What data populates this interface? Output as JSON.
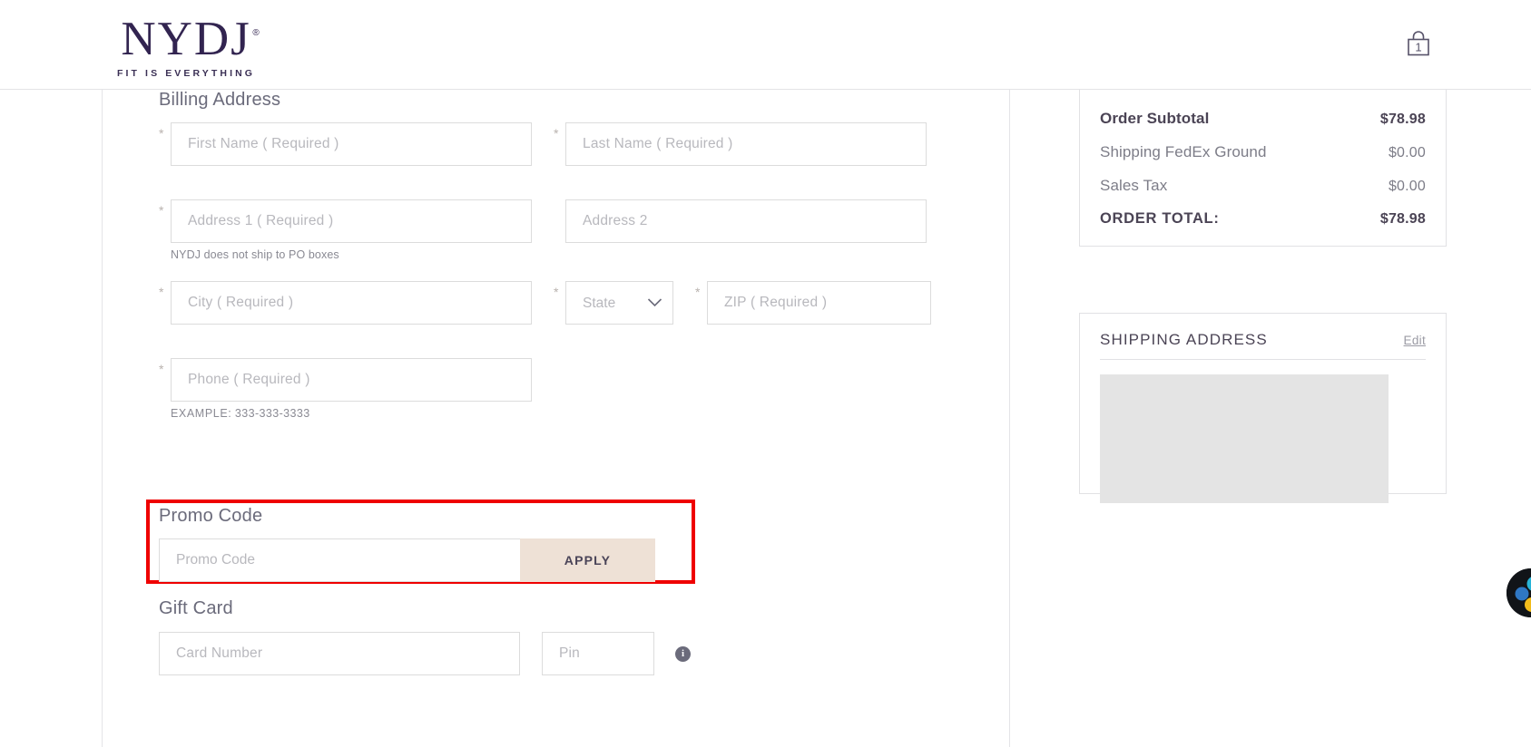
{
  "header": {
    "logo_text": "NYDJ",
    "logo_registered": "®",
    "logo_tagline": "FIT IS EVERYTHING",
    "cart_icon": "shopping-bag-icon",
    "cart_count": "1"
  },
  "billing": {
    "title": "Billing Address",
    "required_marker": "*",
    "first_name_placeholder": "First Name ( Required )",
    "last_name_placeholder": "Last Name ( Required )",
    "address1_placeholder": "Address 1 ( Required )",
    "address2_placeholder": "Address 2",
    "po_box_note": "NYDJ does not ship to PO boxes",
    "city_placeholder": "City ( Required )",
    "state_placeholder": "State",
    "state_chevron_icon": "chevron-down-icon",
    "zip_placeholder": "ZIP ( Required )",
    "phone_placeholder": "Phone ( Required )",
    "phone_example_label": "EXAMPLE:",
    "phone_example_value": "333-333-3333"
  },
  "promo": {
    "title": "Promo Code",
    "input_placeholder": "Promo Code",
    "apply_label": "APPLY",
    "highlight_color": "#ef0000",
    "apply_bg_color": "#eee1d6"
  },
  "gift_card": {
    "title": "Gift Card",
    "card_number_placeholder": "Card Number",
    "pin_placeholder": "Pin",
    "info_icon": "info-icon",
    "info_glyph": "i"
  },
  "summary": {
    "rows": [
      {
        "label": "Order Subtotal",
        "value": "$78.98",
        "strong": true
      },
      {
        "label": "Shipping FedEx Ground",
        "value": "$0.00",
        "strong": false
      },
      {
        "label": "Sales Tax",
        "value": "$0.00",
        "strong": false
      },
      {
        "label": "ORDER TOTAL:",
        "value": "$78.98",
        "strong": true
      }
    ]
  },
  "shipping_address": {
    "title": "SHIPPING ADDRESS",
    "edit_label": "Edit"
  },
  "widget": {
    "name": "support-widget-icon"
  }
}
